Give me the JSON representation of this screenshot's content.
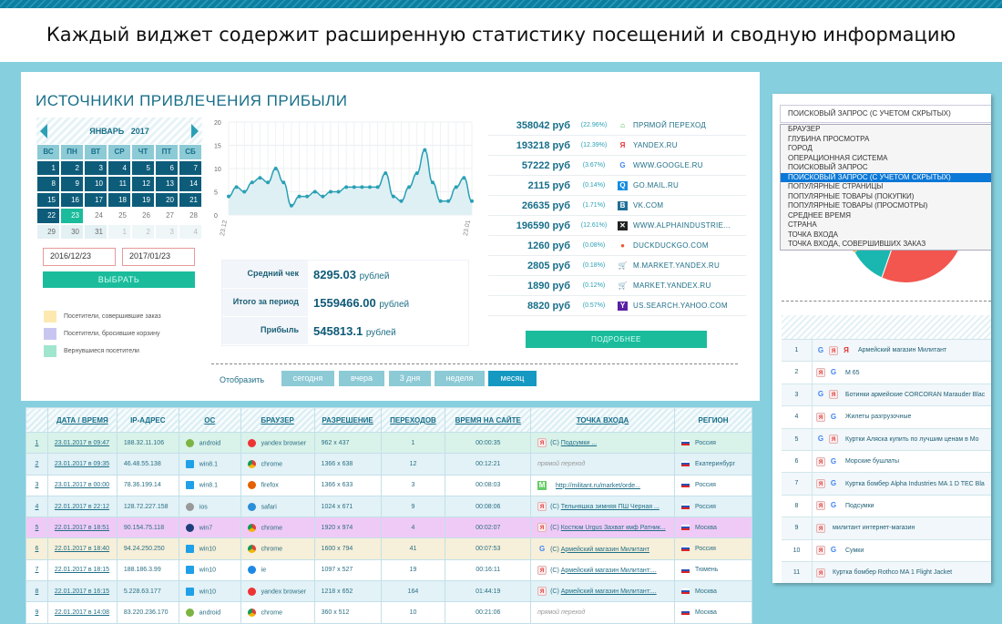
{
  "header": {
    "title": "Каждый виджет содержит расширенную статистику посещений и сводную информацию"
  },
  "widget": {
    "title": "ИСТОЧНИКИ ПРИВЛЕЧЕНИЯ ПРИБЫЛИ",
    "calendar": {
      "month": "ЯНВАРЬ",
      "year": "2017",
      "weekdays": [
        "ВС",
        "ПН",
        "ВТ",
        "СР",
        "ЧТ",
        "ПТ",
        "СБ"
      ],
      "days": [
        "1",
        "2",
        "3",
        "4",
        "5",
        "6",
        "7",
        "8",
        "9",
        "10",
        "11",
        "12",
        "13",
        "14",
        "15",
        "16",
        "17",
        "18",
        "19",
        "20",
        "21",
        "22",
        "23",
        "24",
        "25",
        "26",
        "27",
        "28",
        "29",
        "30",
        "31",
        "1",
        "2",
        "3",
        "4"
      ],
      "selected_range_end": "23"
    },
    "date_from": "2016/12/23",
    "date_to": "2017/01/23",
    "select_label": "ВЫБРАТЬ",
    "legend": [
      {
        "label": "Посетители, совершившие заказ",
        "color": "#fde9b0"
      },
      {
        "label": "Посетители, бросившие корзину",
        "color": "#c8c6f0"
      },
      {
        "label": "Вернувшиеся посетители",
        "color": "#a0e6cf"
      }
    ],
    "stats": [
      {
        "label": "Средний чек",
        "value": "8295.03",
        "unit": "рублей"
      },
      {
        "label": "Итого за период",
        "value": "1559466.00",
        "unit": "рублей"
      },
      {
        "label": "Прибыль",
        "value": "545813.1",
        "unit": "рублей"
      }
    ],
    "filter": {
      "label": "Отобразить",
      "buttons": [
        "сегодня",
        "вчера",
        "3 дня",
        "неделя",
        "месяц"
      ],
      "active": "месяц"
    },
    "sources": [
      {
        "amount": "358042 руб",
        "pct": "(22.96%)",
        "name": "ПРЯМОЙ ПЕРЕХОД",
        "icon": "home-icon"
      },
      {
        "amount": "193218 руб",
        "pct": "(12.39%)",
        "name": "YANDEX.RU",
        "icon": "yandex-icon"
      },
      {
        "amount": "57222 руб",
        "pct": "(3.67%)",
        "name": "WWW.GOOGLE.RU",
        "icon": "google-icon"
      },
      {
        "amount": "2115 руб",
        "pct": "(0.14%)",
        "name": "GO.MAIL.RU",
        "icon": "mail-search-icon"
      },
      {
        "amount": "26635 руб",
        "pct": "(1.71%)",
        "name": "VK.COM",
        "icon": "vk-icon"
      },
      {
        "amount": "196590 руб",
        "pct": "(12.61%)",
        "name": "WWW.ALPHAINDUSTRIE...",
        "icon": "alpha-industries-icon"
      },
      {
        "amount": "1260 руб",
        "pct": "(0.08%)",
        "name": "DUCKDUCKGO.COM",
        "icon": "duckduckgo-icon"
      },
      {
        "amount": "2805 руб",
        "pct": "(0.18%)",
        "name": "M.MARKET.YANDEX.RU",
        "icon": "cart-icon"
      },
      {
        "amount": "1890 руб",
        "pct": "(0.12%)",
        "name": "MARKET.YANDEX.RU",
        "icon": "cart-icon"
      },
      {
        "amount": "8820 руб",
        "pct": "(0.57%)",
        "name": "US.SEARCH.YAHOO.COM",
        "icon": "yahoo-icon"
      }
    ],
    "more_label": "ПОДРОБНЕЕ"
  },
  "chart_data": {
    "type": "area",
    "x_tick_labels": [
      "23.12",
      "23.01"
    ],
    "yticks": [
      0,
      5,
      10,
      15,
      20
    ],
    "ylim": [
      0,
      20
    ],
    "grid": true,
    "values": [
      4,
      6,
      5,
      7,
      8,
      7,
      10,
      7,
      2,
      4,
      4,
      5,
      4,
      5,
      5,
      6,
      6,
      6,
      6,
      6,
      9,
      4,
      3,
      6,
      9,
      14,
      7,
      3,
      3,
      6,
      8,
      3
    ],
    "color": "#2aa0b5"
  },
  "right_panel": {
    "selected": "ПОИСКОВЫЙ ЗАПРОС (С УЧЕТОМ СКРЫТЫХ)",
    "options": [
      "БРАУЗЕР",
      "ГЛУБИНА ПРОСМОТРА",
      "ГОРОД",
      "ОПЕРАЦИОННАЯ СИСТЕМА",
      "ПОИСКОВЫЙ ЗАПРОС",
      "ПОИСКОВЫЙ ЗАПРОС (С УЧЕТОМ СКРЫТЫХ)",
      "ПОПУЛЯРНЫЕ СТРАНИЦЫ",
      "ПОПУЛЯРНЫЕ ТОВАРЫ (ПОКУПКИ)",
      "ПОПУЛЯРНЫЕ ТОВАРЫ (ПРОСМОТРЫ)",
      "СРЕДНЕЕ ВРЕМЯ",
      "СТРАНА",
      "ТОЧКА ВХОДА",
      "ТОЧКА ВХОДА, СОВЕРШИВШИХ ЗАКАЗ"
    ],
    "pie_colors": [
      "#f2564f",
      "#1ab7b0",
      "#f6b04a"
    ],
    "queries": [
      {
        "n": "1",
        "icons": [
          "G",
          "Я",
          "Y"
        ],
        "text": "Армейский магазин Милитант"
      },
      {
        "n": "2",
        "icons": [
          "Я",
          "G"
        ],
        "text": "М 65"
      },
      {
        "n": "3",
        "icons": [
          "G",
          "Я"
        ],
        "text": "Ботинки армейские CORCORAN Marauder Blac"
      },
      {
        "n": "4",
        "icons": [
          "Я",
          "G"
        ],
        "text": "Жилеты разгрузочные"
      },
      {
        "n": "5",
        "icons": [
          "G",
          "Я"
        ],
        "text": "Куртки Аляска купить по лучшим ценам в Мо"
      },
      {
        "n": "6",
        "icons": [
          "Я",
          "G"
        ],
        "text": "Морские бушлаты"
      },
      {
        "n": "7",
        "icons": [
          "Я",
          "G"
        ],
        "text": "Куртка бомбер Alpha Industries MA 1 D TEC Bla"
      },
      {
        "n": "8",
        "icons": [
          "Я",
          "G"
        ],
        "text": "Подсумки"
      },
      {
        "n": "9",
        "icons": [
          "Я"
        ],
        "text": "милитант интернет-магазин"
      },
      {
        "n": "10",
        "icons": [
          "Я",
          "G"
        ],
        "text": "Сумки"
      },
      {
        "n": "11",
        "icons": [
          "Я"
        ],
        "text": "Куртка бомбер Rothco MA 1 Flight Jacket"
      }
    ]
  },
  "visits": {
    "columns": [
      "",
      "ДАТА / ВРЕМЯ",
      "IP-АДРЕС",
      "ОС",
      "БРАУЗЕР",
      "РАЗРЕШЕНИЕ",
      "ПЕРЕХОДОВ",
      "ВРЕМЯ НА САЙТЕ",
      "ТОЧКА ВХОДА",
      "РЕГИОН"
    ],
    "rows": [
      {
        "n": "1",
        "date": "23.01.2017 в 09:47",
        "ip": "188.32.11.106",
        "os": "android",
        "browser": "yandex browser",
        "res": "962 x 437",
        "hits": "1",
        "time": "00:00:35",
        "entry": "Подсумки ...",
        "entry_prefix": "(С)",
        "entry_src": "yandex",
        "region": "Россия",
        "bg": "#d9f2ea"
      },
      {
        "n": "2",
        "date": "23.01.2017 в 09:35",
        "ip": "46.48.55.138",
        "os": "win8.1",
        "browser": "chrome",
        "res": "1366 x 638",
        "hits": "12",
        "time": "00:12:21",
        "entry": "прямой переход",
        "entry_prefix": "",
        "entry_src": "direct",
        "region": "Екатеринбург",
        "bg": "#e2f2f7"
      },
      {
        "n": "3",
        "date": "23.01.2017 в 00:00",
        "ip": "78.36.199.14",
        "os": "win8.1",
        "browser": "firefox",
        "res": "1366 x 633",
        "hits": "3",
        "time": "00:08:03",
        "entry": "http://militant.ru/market/orde...",
        "entry_prefix": "",
        "entry_src": "mail",
        "region": "Россия",
        "bg": "#ffffff"
      },
      {
        "n": "4",
        "date": "22.01.2017 в 22:12",
        "ip": "128.72.227.158",
        "os": "ios",
        "browser": "safari",
        "res": "1024 x 671",
        "hits": "9",
        "time": "00:08:06",
        "entry": "Тельняшка зимняя ПШ Черная ...",
        "entry_prefix": "(С)",
        "entry_src": "yandex",
        "region": "Россия",
        "bg": "#e2f2f7"
      },
      {
        "n": "5",
        "date": "22.01.2017 в 18:51",
        "ip": "90.154.75.118",
        "os": "win7",
        "browser": "chrome",
        "res": "1920 x 974",
        "hits": "4",
        "time": "00:02:07",
        "entry": "Костюм Urgus Захват кмф Ратник...",
        "entry_prefix": "(С)",
        "entry_src": "yandex",
        "region": "Москва",
        "bg": "#efcaf6"
      },
      {
        "n": "6",
        "date": "22.01.2017 в 18:40",
        "ip": "94.24.250.250",
        "os": "win10",
        "browser": "chrome",
        "res": "1600 x 794",
        "hits": "41",
        "time": "00:07:53",
        "entry": "Армейский магазин Милитант",
        "entry_prefix": "(С)",
        "entry_src": "google",
        "region": "Россия",
        "bg": "#f6efd9"
      },
      {
        "n": "7",
        "date": "22.01.2017 в 18:15",
        "ip": "188.186.3.99",
        "os": "win10",
        "browser": "ie",
        "res": "1097 x 527",
        "hits": "19",
        "time": "00:16:11",
        "entry": "Армейский магазин Милитант:...",
        "entry_prefix": "(С)",
        "entry_src": "yandex",
        "region": "Тюмень",
        "bg": "#ffffff"
      },
      {
        "n": "8",
        "date": "22.01.2017 в 16:15",
        "ip": "5.228.63.177",
        "os": "win10",
        "browser": "yandex browser",
        "res": "1218 x 652",
        "hits": "164",
        "time": "01:44:19",
        "entry": "Армейский магазин Милитант:...",
        "entry_prefix": "(С)",
        "entry_src": "yandex",
        "region": "Москва",
        "bg": "#e2f2f7"
      },
      {
        "n": "9",
        "date": "22.01.2017 в 14:08",
        "ip": "83.220.236.170",
        "os": "android",
        "browser": "chrome",
        "res": "360 x 512",
        "hits": "10",
        "time": "00:21:06",
        "entry": "прямой переход",
        "entry_prefix": "",
        "entry_src": "direct",
        "region": "Москва",
        "bg": "#ffffff"
      }
    ]
  }
}
